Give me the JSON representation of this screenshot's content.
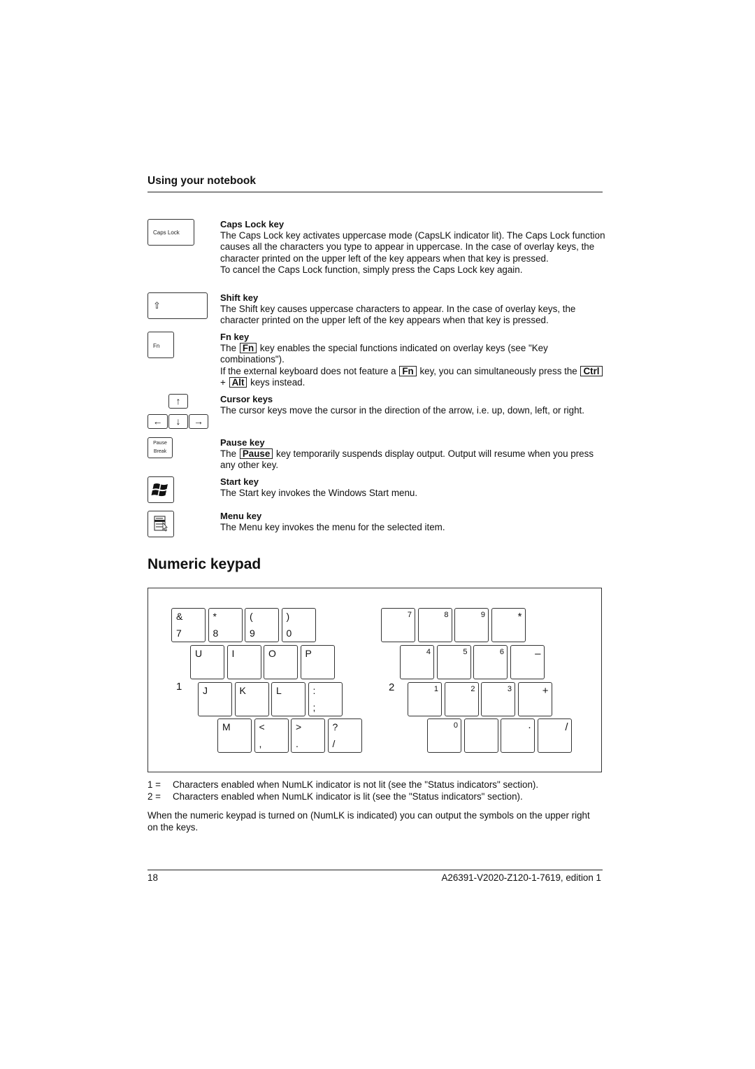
{
  "header": {
    "section_title": "Using your notebook"
  },
  "entries": [
    {
      "icon": "caps-lock-key-icon",
      "icon_label": "Caps Lock",
      "title": "Caps Lock key",
      "body": "The Caps Lock key activates uppercase mode (CapsLK indicator lit). The Caps Lock function causes all the characters you type to appear in uppercase. In the case of overlay keys, the character printed on the upper left of the key appears when that key is pressed.",
      "body2": "To cancel the Caps Lock function, simply press the Caps Lock key again."
    },
    {
      "icon": "shift-key-icon",
      "icon_label": "⇧",
      "title": "Shift key",
      "body": "The Shift key causes uppercase characters to appear. In the case of overlay keys, the character printed on the upper left of the key appears when that key is pressed."
    },
    {
      "icon": "fn-key-icon",
      "icon_label": "Fn",
      "title": "Fn key",
      "body_pre": "The",
      "key1": "Fn",
      "body_post": "key enables the special functions indicated on overlay keys (see \"Key combinations\").",
      "body2_pre": "If the external keyboard does not feature a",
      "key2": "Fn",
      "body2_mid": "key, you can simultaneously press the",
      "key3": "Ctrl",
      "plus": "+",
      "key4": "Alt",
      "body2_post": "keys instead."
    },
    {
      "icon": "cursor-keys-icon",
      "arrows": {
        "up": "↑",
        "left": "←",
        "down": "↓",
        "right": "→"
      },
      "title": "Cursor keys",
      "body": "The cursor keys move the cursor in the direction of the arrow, i.e. up, down, left, or right."
    },
    {
      "icon": "pause-break-key-icon",
      "icon_label_1": "Pause",
      "icon_label_2": "Break",
      "title": "Pause key",
      "body_pre": "The",
      "key1": "Pause",
      "body_post": "key temporarily suspends display output. Output will resume when you press any other key."
    },
    {
      "icon": "windows-start-key-icon",
      "title": "Start key",
      "body": "The Start key invokes the Windows Start menu."
    },
    {
      "icon": "menu-key-icon",
      "title": "Menu key",
      "body": "The Menu key invokes the menu for the selected item."
    }
  ],
  "numeric_keypad": {
    "heading": "Numeric keypad",
    "figure": {
      "marker_1": "1",
      "marker_2": "2",
      "layout_1": [
        [
          {
            "top": "&",
            "bottom": "7"
          },
          {
            "top": "*",
            "bottom": "8"
          },
          {
            "top": "(",
            "bottom": "9"
          },
          {
            "top": ")",
            "bottom": "0"
          }
        ],
        [
          {
            "top": "U",
            "bottom": ""
          },
          {
            "top": "I",
            "bottom": ""
          },
          {
            "top": "O",
            "bottom": ""
          },
          {
            "top": "P",
            "bottom": ""
          }
        ],
        [
          {
            "top": "J",
            "bottom": ""
          },
          {
            "top": "K",
            "bottom": ""
          },
          {
            "top": "L",
            "bottom": ""
          },
          {
            "top": ":",
            "bottom": ";"
          }
        ],
        [
          {
            "top": "M",
            "bottom": ""
          },
          {
            "top": "<",
            "bottom": ","
          },
          {
            "top": ">",
            "bottom": "."
          },
          {
            "top": "?",
            "bottom": "/"
          }
        ]
      ],
      "layout_2": [
        [
          "7",
          "8",
          "9",
          "*"
        ],
        [
          "4",
          "5",
          "6",
          "–"
        ],
        [
          "1",
          "2",
          "3",
          "+"
        ],
        [
          "0",
          "",
          "·",
          "/"
        ]
      ]
    },
    "legend": [
      {
        "marker": "1 =",
        "text": "Characters enabled when NumLK indicator is not lit (see the \"Status indicators\" section)."
      },
      {
        "marker": "2 =",
        "text": "Characters enabled when NumLK indicator is lit (see the \"Status indicators\" section)."
      }
    ],
    "note": "When the numeric keypad is turned on (NumLK is indicated) you can output the symbols on the upper right on the keys."
  },
  "footer": {
    "page_number": "18",
    "doc_id": "A26391-V2020-Z120-1-7619, edition 1"
  }
}
